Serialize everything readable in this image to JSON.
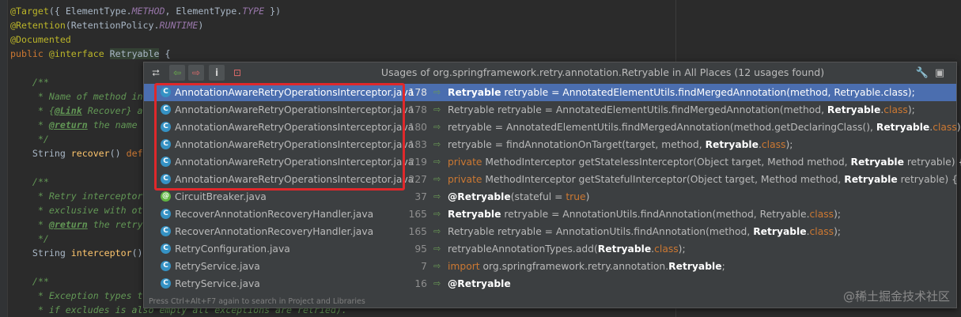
{
  "editor": {
    "lines": [
      {
        "segments": [
          {
            "c": "ann",
            "t": "@Target"
          },
          {
            "c": "",
            "t": "({ ElementType."
          },
          {
            "c": "it",
            "t": "METHOD"
          },
          {
            "c": "",
            "t": ", ElementType."
          },
          {
            "c": "it",
            "t": "TYPE"
          },
          {
            "c": "",
            "t": " })"
          }
        ]
      },
      {
        "segments": [
          {
            "c": "ann",
            "t": "@Retention"
          },
          {
            "c": "",
            "t": "(RetentionPolicy."
          },
          {
            "c": "it",
            "t": "RUNTIME"
          },
          {
            "c": "",
            "t": ")"
          }
        ]
      },
      {
        "segments": [
          {
            "c": "ann",
            "t": "@Documented"
          }
        ]
      },
      {
        "segments": [
          {
            "c": "kw",
            "t": "public "
          },
          {
            "c": "ann",
            "t": "@interface "
          },
          {
            "c": "cls",
            "t": "Retryable"
          },
          {
            "c": "",
            "t": " {"
          }
        ]
      },
      {
        "segments": []
      },
      {
        "segments": [
          {
            "c": "cm",
            "t": "    /**"
          }
        ]
      },
      {
        "segments": [
          {
            "c": "cm",
            "t": "     * Name of method in"
          }
        ]
      },
      {
        "segments": [
          {
            "c": "cm",
            "t": "     * {"
          },
          {
            "c": "tag",
            "t": "@Link"
          },
          {
            "c": "cm",
            "t": " Recover} a"
          }
        ]
      },
      {
        "segments": [
          {
            "c": "cm",
            "t": "     * "
          },
          {
            "c": "tag",
            "t": "@return"
          },
          {
            "c": "cm",
            "t": " the name"
          }
        ]
      },
      {
        "segments": [
          {
            "c": "cm",
            "t": "     */"
          }
        ]
      },
      {
        "segments": [
          {
            "c": "",
            "t": "    String "
          },
          {
            "c": "fn",
            "t": "recover"
          },
          {
            "c": "",
            "t": "() "
          },
          {
            "c": "kw",
            "t": "def"
          }
        ]
      },
      {
        "segments": []
      },
      {
        "segments": [
          {
            "c": "cm",
            "t": "    /**"
          }
        ]
      },
      {
        "segments": [
          {
            "c": "cm",
            "t": "     * Retry interceptor"
          }
        ]
      },
      {
        "segments": [
          {
            "c": "cm",
            "t": "     * exclusive with ot"
          }
        ]
      },
      {
        "segments": [
          {
            "c": "cm",
            "t": "     * "
          },
          {
            "c": "tag",
            "t": "@return"
          },
          {
            "c": "cm",
            "t": " the retry"
          }
        ]
      },
      {
        "segments": [
          {
            "c": "cm",
            "t": "     */"
          }
        ]
      },
      {
        "segments": [
          {
            "c": "",
            "t": "    String "
          },
          {
            "c": "fn",
            "t": "interceptor"
          },
          {
            "c": "",
            "t": "()"
          }
        ]
      },
      {
        "segments": []
      },
      {
        "segments": [
          {
            "c": "cm",
            "t": "    /**"
          }
        ]
      },
      {
        "segments": [
          {
            "c": "cm",
            "t": "     * Exception types t"
          }
        ]
      },
      {
        "segments": [
          {
            "c": "cm",
            "t": "     * if excludes is also empty all exceptions are retried)."
          }
        ]
      }
    ]
  },
  "popup": {
    "title": "Usages of org.springframework.retry.annotation.Retryable in All Places (12 usages found)",
    "toolbar": {
      "merge_icon": "⮂",
      "prev_icon": "⇦",
      "next_icon": "⇨",
      "info_icon": "i",
      "filter_icon": "⊡"
    },
    "settings_icon": "🔧",
    "pin_icon": "▣",
    "hint": "Press Ctrl+Alt+F7 again to search in Project and Libraries",
    "usages": [
      {
        "file": "AnnotationAwareRetryOperationsInterceptor.java",
        "icon": "C",
        "green": false,
        "line": "178",
        "selected": true,
        "code": [
          {
            "c": "b",
            "t": "Retryable"
          },
          {
            "c": "",
            "t": " retryable = AnnotatedElementUtils.findMergedAnnotation(method, Retryable.class);"
          }
        ]
      },
      {
        "file": "AnnotationAwareRetryOperationsInterceptor.java",
        "icon": "C",
        "green": false,
        "line": "178",
        "selected": false,
        "code": [
          {
            "c": "",
            "t": "Retryable retryable = AnnotatedElementUtils.findMergedAnnotation(method, "
          },
          {
            "c": "b",
            "t": "Retryable"
          },
          {
            "c": "",
            "t": "."
          },
          {
            "c": "k",
            "t": "class"
          },
          {
            "c": "",
            "t": ");"
          }
        ]
      },
      {
        "file": "AnnotationAwareRetryOperationsInterceptor.java",
        "icon": "C",
        "green": false,
        "line": "180",
        "selected": false,
        "code": [
          {
            "c": "",
            "t": "retryable = AnnotatedElementUtils.findMergedAnnotation(method.getDeclaringClass(), "
          },
          {
            "c": "b",
            "t": "Retryable"
          },
          {
            "c": "",
            "t": "."
          },
          {
            "c": "k",
            "t": "class"
          },
          {
            "c": "",
            "t": ");"
          }
        ]
      },
      {
        "file": "AnnotationAwareRetryOperationsInterceptor.java",
        "icon": "C",
        "green": false,
        "line": "183",
        "selected": false,
        "code": [
          {
            "c": "",
            "t": "retryable = findAnnotationOnTarget(target, method, "
          },
          {
            "c": "b",
            "t": "Retryable"
          },
          {
            "c": "",
            "t": "."
          },
          {
            "c": "k",
            "t": "class"
          },
          {
            "c": "",
            "t": ");"
          }
        ]
      },
      {
        "file": "AnnotationAwareRetryOperationsInterceptor.java",
        "icon": "C",
        "green": false,
        "line": "219",
        "selected": false,
        "code": [
          {
            "c": "k",
            "t": "private "
          },
          {
            "c": "",
            "t": "MethodInterceptor getStatelessInterceptor(Object target, Method method, "
          },
          {
            "c": "b",
            "t": "Retryable"
          },
          {
            "c": "",
            "t": " retryable) {"
          }
        ]
      },
      {
        "file": "AnnotationAwareRetryOperationsInterceptor.java",
        "icon": "C",
        "green": false,
        "line": "227",
        "selected": false,
        "code": [
          {
            "c": "k",
            "t": "private "
          },
          {
            "c": "",
            "t": "MethodInterceptor getStatefulInterceptor(Object target, Method method, "
          },
          {
            "c": "b",
            "t": "Retryable"
          },
          {
            "c": "",
            "t": " retryable) {"
          }
        ]
      },
      {
        "file": "CircuitBreaker.java",
        "icon": "@",
        "green": true,
        "line": "37",
        "selected": false,
        "code": [
          {
            "c": "b",
            "t": "@Retryable"
          },
          {
            "c": "",
            "t": "(stateful = "
          },
          {
            "c": "k",
            "t": "true"
          },
          {
            "c": "",
            "t": ")"
          }
        ]
      },
      {
        "file": "RecoverAnnotationRecoveryHandler.java",
        "icon": "C",
        "green": false,
        "line": "165",
        "selected": false,
        "code": [
          {
            "c": "b",
            "t": "Retryable"
          },
          {
            "c": "",
            "t": " retryable = AnnotationUtils.findAnnotation(method, Retryable."
          },
          {
            "c": "k",
            "t": "class"
          },
          {
            "c": "",
            "t": ");"
          }
        ]
      },
      {
        "file": "RecoverAnnotationRecoveryHandler.java",
        "icon": "C",
        "green": false,
        "line": "165",
        "selected": false,
        "code": [
          {
            "c": "",
            "t": "Retryable retryable = AnnotationUtils.findAnnotation(method, "
          },
          {
            "c": "b",
            "t": "Retryable"
          },
          {
            "c": "",
            "t": "."
          },
          {
            "c": "k",
            "t": "class"
          },
          {
            "c": "",
            "t": ");"
          }
        ]
      },
      {
        "file": "RetryConfiguration.java",
        "icon": "C",
        "green": false,
        "line": "95",
        "selected": false,
        "code": [
          {
            "c": "",
            "t": "retryableAnnotationTypes.add("
          },
          {
            "c": "b",
            "t": "Retryable"
          },
          {
            "c": "",
            "t": "."
          },
          {
            "c": "k",
            "t": "class"
          },
          {
            "c": "",
            "t": ");"
          }
        ]
      },
      {
        "file": "RetryService.java",
        "icon": "C",
        "green": false,
        "line": "7",
        "selected": false,
        "code": [
          {
            "c": "k",
            "t": "import "
          },
          {
            "c": "",
            "t": "org.springframework.retry.annotation."
          },
          {
            "c": "b",
            "t": "Retryable"
          },
          {
            "c": "",
            "t": ";"
          }
        ]
      },
      {
        "file": "RetryService.java",
        "icon": "C",
        "green": false,
        "line": "16",
        "selected": false,
        "code": [
          {
            "c": "b",
            "t": "@Retryable"
          }
        ]
      }
    ]
  },
  "watermark": "@稀土掘金技术社区"
}
